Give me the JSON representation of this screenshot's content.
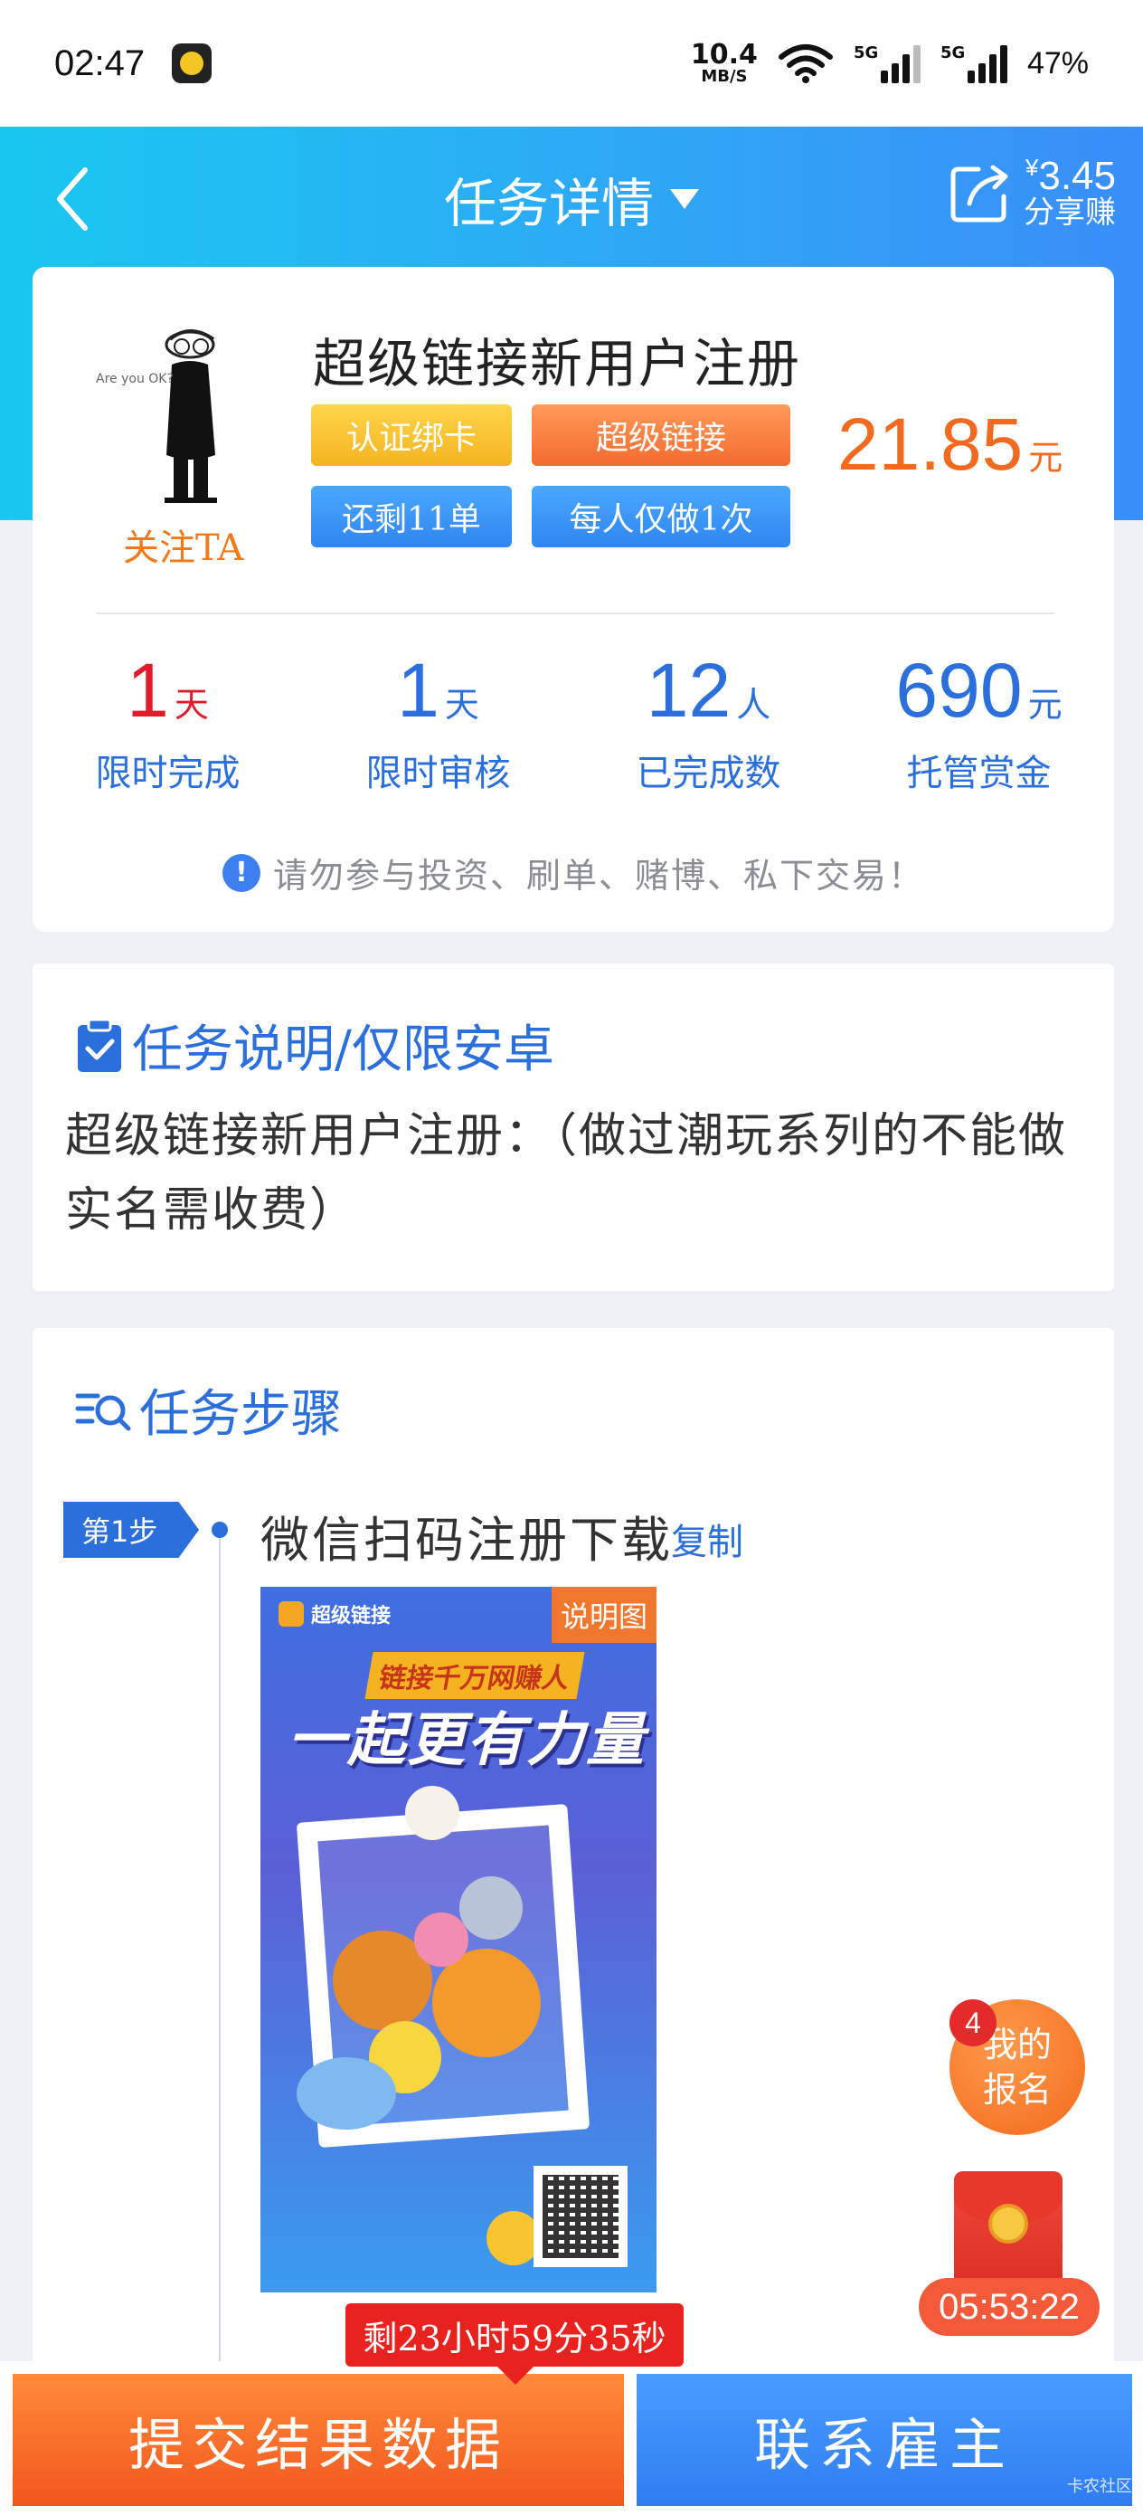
{
  "status_bar": {
    "time": "02:47",
    "net_speed_value": "10.4",
    "net_speed_unit": "MB/S",
    "signal1_label": "5G",
    "signal2_label": "5G",
    "battery": "47%"
  },
  "header": {
    "title": "任务详情",
    "share_amount": "3.45",
    "share_currency": "¥",
    "share_label": "分享赚"
  },
  "task": {
    "follow_label": "关注TA",
    "name": "超级链接新用户注册",
    "tags": [
      "认证绑卡",
      "超级链接",
      "还剩11单",
      "每人仅做1次"
    ],
    "reward": "21.85",
    "reward_unit": "元",
    "stats": [
      {
        "value": "1",
        "unit": "天",
        "caption": "限时完成"
      },
      {
        "value": "1",
        "unit": "天",
        "caption": "限时审核"
      },
      {
        "value": "12",
        "unit": "人",
        "caption": "已完成数"
      },
      {
        "value": "690",
        "unit": "元",
        "caption": "托管赏金"
      }
    ],
    "warning": "请勿参与投资、刷单、赌博、私下交易！"
  },
  "description": {
    "title": "任务说明/仅限安卓",
    "text": "超级链接新用户注册：（做过潮玩系列的不能做 实名需收费）"
  },
  "steps": {
    "title": "任务步骤",
    "items": [
      {
        "flag": "第1步",
        "text": "微信扫码注册下载",
        "copy_label": "复制",
        "image": {
          "badge": "说明图",
          "brand": "超级链接",
          "slogan1": "链接千万网赚人",
          "slogan2": "一起更有力量"
        }
      }
    ]
  },
  "floating": {
    "signup_badge": "4",
    "signup_line1": "我的",
    "signup_line2": "报名",
    "redpacket_timer": "05:53:22"
  },
  "countdown": "剩23小时59分35秒",
  "bottom": {
    "submit_label": "提交结果数据",
    "contact_label": "联系雇主",
    "watermark": "卡农社区"
  }
}
